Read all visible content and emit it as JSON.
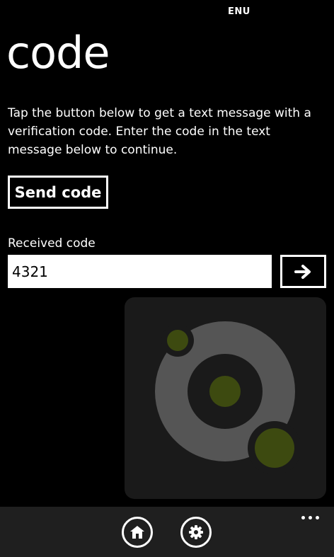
{
  "status_bar": {
    "language": "ENU"
  },
  "page": {
    "title": "code",
    "instructions": "Tap the button below to get a text message with a verification code. Enter the code in the text message below to continue."
  },
  "send_button": {
    "label": "Send code"
  },
  "code_field": {
    "label": "Received code",
    "value": "4321"
  },
  "submit_button": {
    "icon": "arrow-right-icon"
  },
  "logo": {
    "icon": "app-logo-icon"
  },
  "app_bar": {
    "home_icon": "home-icon",
    "settings_icon": "gear-icon",
    "more_icon": "more-dots-icon"
  },
  "colors": {
    "background": "#000000",
    "foreground": "#ffffff",
    "logo_panel": "#1a1a1a",
    "logo_ring": "#555555",
    "logo_accent": "#3d4a10",
    "app_bar": "#1f1f1f"
  }
}
